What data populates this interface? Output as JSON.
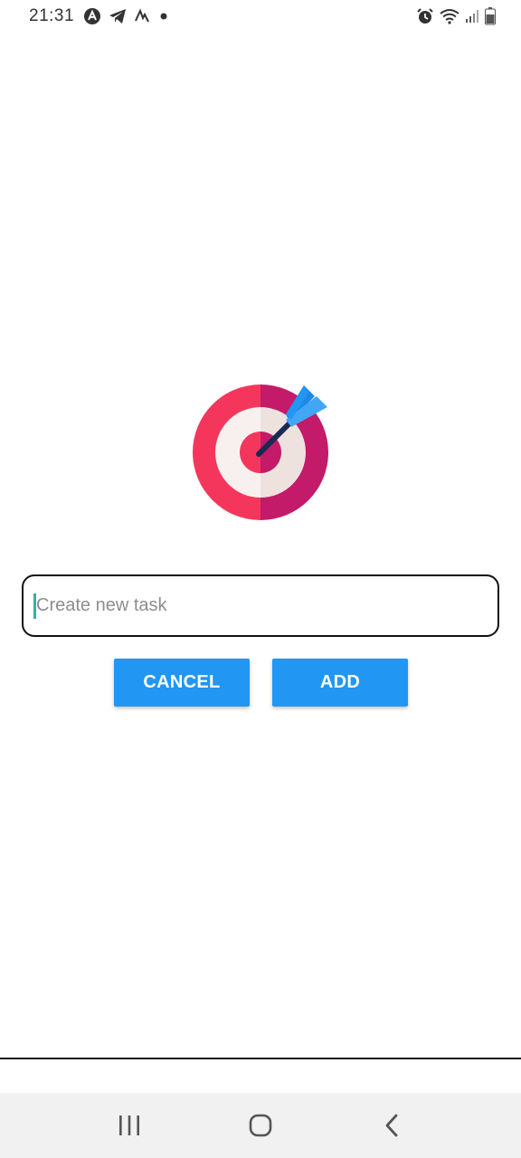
{
  "status_bar": {
    "time": "21:31",
    "left_icons": [
      "app-notification-icon",
      "telegram-icon",
      "activity-icon",
      "notification-dot-icon"
    ],
    "right_icons": [
      "alarm-icon",
      "wifi-icon",
      "signal-icon",
      "battery-icon"
    ]
  },
  "main": {
    "logo_icon": "target-dart-icon",
    "task_input": {
      "placeholder": "Create new task",
      "value": ""
    },
    "cancel_label": "CANCEL",
    "add_label": "ADD"
  },
  "navigation": {
    "icons": [
      "recent-apps-icon",
      "home-icon",
      "back-icon"
    ]
  },
  "colors": {
    "accent": "#2196f3",
    "target_red": "#f5365c",
    "target_magenta": "#c41a6a",
    "dart_blue": "#1e88e5",
    "caret": "#2bb3a8"
  }
}
